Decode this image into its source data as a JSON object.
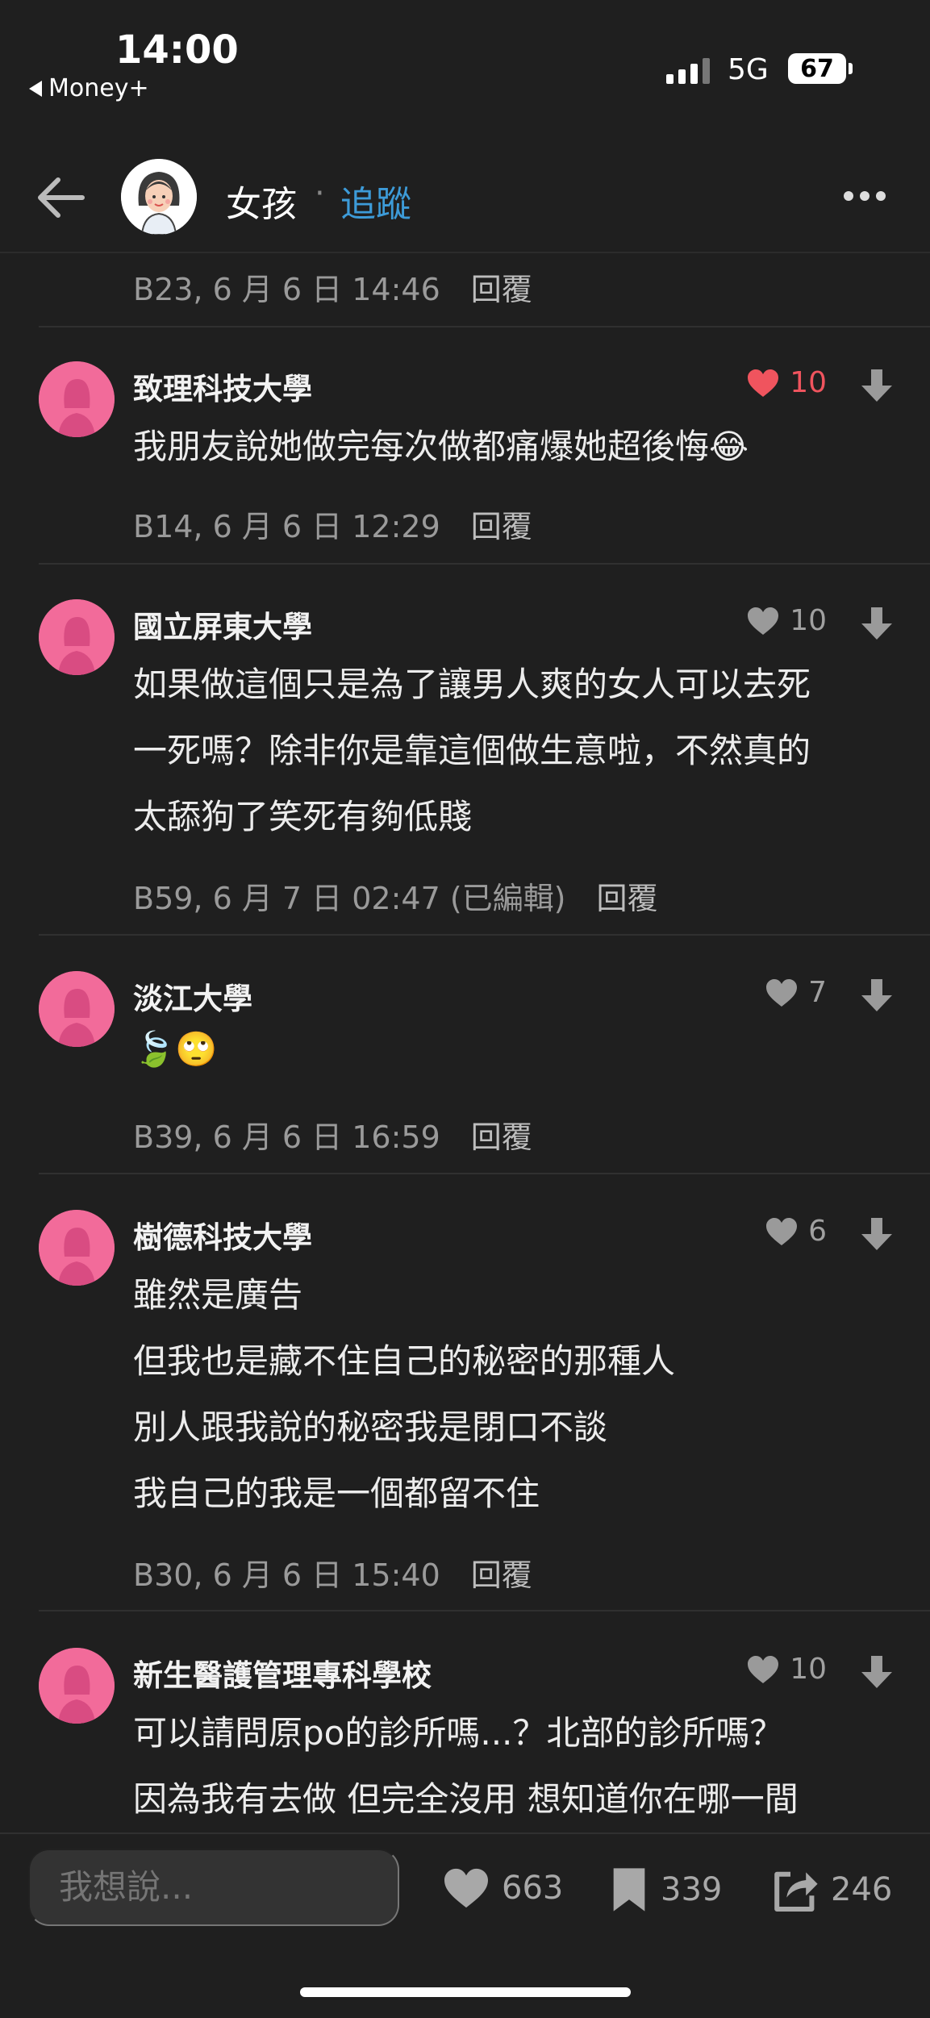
{
  "status_bar": {
    "time": "14:00",
    "back_app": "Money+",
    "network": "5G",
    "battery": "67"
  },
  "header": {
    "author": "女孩",
    "separator": "·",
    "follow": "追蹤"
  },
  "top_meta": {
    "floor_time": "B23, 6 月 6 日 14:46",
    "reply": "回覆"
  },
  "comments": [
    {
      "school": "致理科技大學",
      "likes": "10",
      "liked": true,
      "lines": [
        "我朋友說她做完每次做都痛爆她超後悔😂"
      ],
      "meta": "B14, 6 月 6 日 12:29",
      "reply": "回覆"
    },
    {
      "school": "國立屏東大學",
      "likes": "10",
      "liked": false,
      "lines": [
        "如果做這個只是為了讓男人爽的女人可以去死",
        "一死嗎？除非你是靠這個做生意啦，不然真的",
        "太舔狗了笑死有夠低賤"
      ],
      "meta": "B59, 6 月 7 日 02:47 (已編輯)",
      "reply": "回覆"
    },
    {
      "school": "淡江大學",
      "likes": "7",
      "liked": false,
      "lines": [
        "🍃🙄"
      ],
      "meta": "B39, 6 月 6 日 16:59",
      "reply": "回覆"
    },
    {
      "school": "樹德科技大學",
      "likes": "6",
      "liked": false,
      "lines": [
        "雖然是廣告",
        "但我也是藏不住自己的秘密的那種人",
        "別人跟我說的秘密我是閉口不談",
        "我自己的我是一個都留不住"
      ],
      "meta": "B30, 6 月 6 日 15:40",
      "reply": "回覆"
    },
    {
      "school": "新生醫護管理專科學校",
      "likes": "10",
      "liked": false,
      "lines": [
        "可以請問原po的診所嗎...？北部的診所嗎？",
        "因為我有去做 但完全沒用 想知道你在哪一間"
      ],
      "meta": "",
      "reply": ""
    }
  ],
  "bottom_bar": {
    "input_placeholder": "我想說...",
    "likes": "663",
    "saves": "339",
    "shares": "246"
  },
  "colors": {
    "background": "#1f1f1f",
    "link": "#3d9bd8",
    "liked": "#f0545e",
    "avatar": "#f26b9a"
  }
}
